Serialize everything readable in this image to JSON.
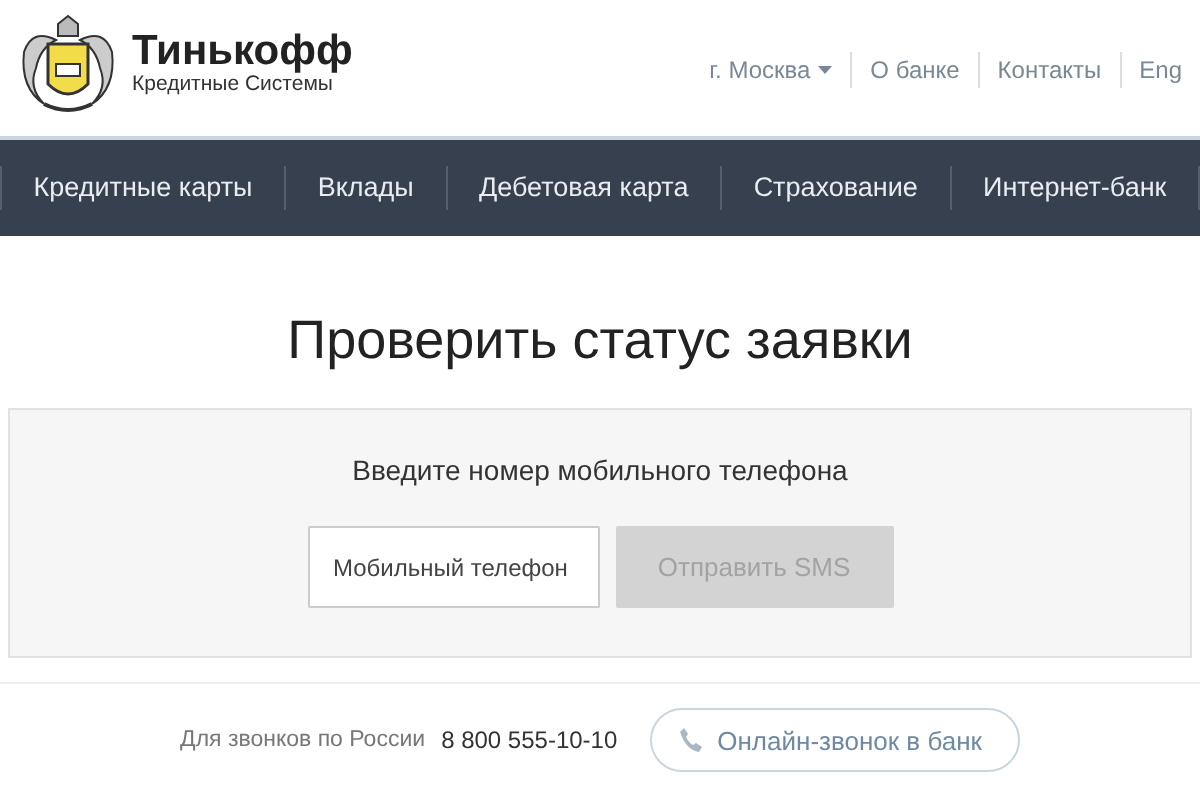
{
  "logo": {
    "name": "Тинькофф",
    "tagline": "Кредитные Системы"
  },
  "top_links": [
    {
      "label": "г. Москва",
      "dropdown": true
    },
    {
      "label": "О банке",
      "dropdown": false
    },
    {
      "label": "Контакты",
      "dropdown": false
    },
    {
      "label": "Eng",
      "dropdown": false
    }
  ],
  "nav": [
    "Кредитные карты",
    "Вклады",
    "Дебетовая карта",
    "Страхование",
    "Интернет-банк"
  ],
  "title": "Проверить статус заявки",
  "form": {
    "prompt": "Введите номер мобильного телефона",
    "phone_field": {
      "placeholder": "Мобильный телефон"
    },
    "submit": {
      "label": "Отправить SMS",
      "disabled": true
    }
  },
  "footer": {
    "text": "Для звонков по России",
    "phone": "8 800 555-10-10",
    "call_button": "Онлайн-звонок в банк"
  }
}
